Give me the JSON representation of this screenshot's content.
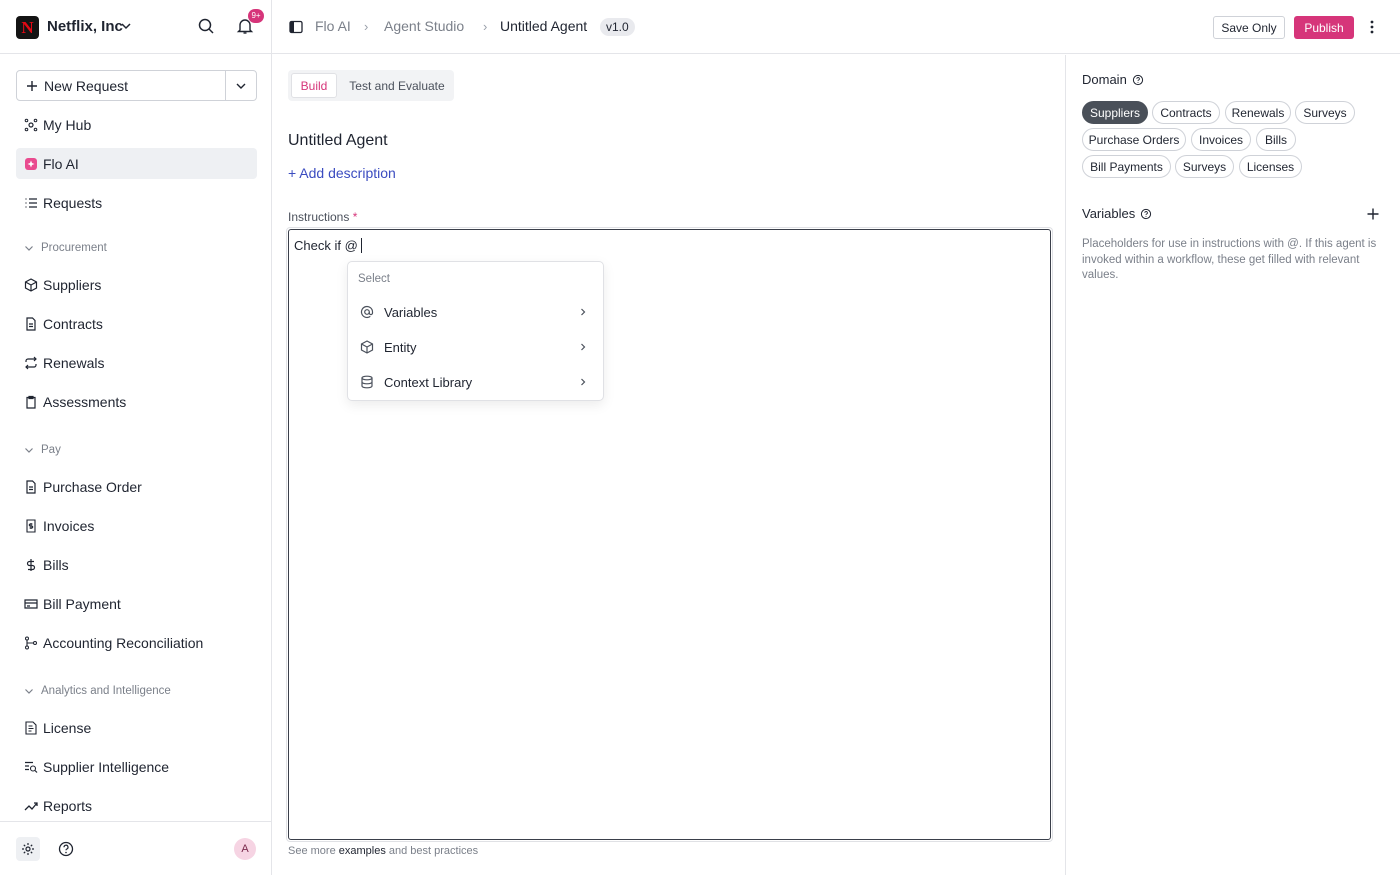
{
  "org": {
    "name": "Netflix, Inc",
    "logo_letter": "N",
    "notifications": "9+"
  },
  "sidebar": {
    "new_request": "New Request",
    "items_top": [
      {
        "label": "My Hub",
        "icon": "hub-icon"
      },
      {
        "label": "Flo AI",
        "icon": "flo-ai-icon"
      },
      {
        "label": "Requests",
        "icon": "list-icon"
      }
    ],
    "sections": [
      {
        "title": "Procurement",
        "items": [
          {
            "label": "Suppliers",
            "icon": "cube-icon"
          },
          {
            "label": "Contracts",
            "icon": "document-icon"
          },
          {
            "label": "Renewals",
            "icon": "repeat-icon"
          },
          {
            "label": "Assessments",
            "icon": "clipboard-icon"
          }
        ]
      },
      {
        "title": "Pay",
        "items": [
          {
            "label": "Purchase Order",
            "icon": "document-icon"
          },
          {
            "label": "Invoices",
            "icon": "receipt-icon"
          },
          {
            "label": "Bills",
            "icon": "dollar-icon"
          },
          {
            "label": "Bill Payment",
            "icon": "card-icon"
          },
          {
            "label": "Accounting Reconciliation",
            "icon": "branch-icon"
          }
        ]
      },
      {
        "title": "Analytics and Intelligence",
        "items": [
          {
            "label": "License",
            "icon": "license-icon"
          },
          {
            "label": "Supplier Intelligence",
            "icon": "search-list-icon"
          },
          {
            "label": "Reports",
            "icon": "trend-icon"
          }
        ]
      }
    ],
    "avatar": "A"
  },
  "header": {
    "breadcrumbs": [
      "Flo AI",
      "Agent Studio",
      "Untitled Agent"
    ],
    "version": "v1.0",
    "save_label": "Save Only",
    "publish_label": "Publish"
  },
  "main": {
    "tabs": [
      "Build",
      "Test and Evaluate"
    ],
    "agent_title": "Untitled Agent",
    "add_description": "+ Add description",
    "instructions_label": "Instructions",
    "required_mark": "*",
    "instructions_value": "Check if @",
    "dropdown": {
      "header": "Select",
      "items": [
        "Variables",
        "Entity",
        "Context Library"
      ]
    },
    "hint_prefix": "See more ",
    "hint_link": "examples",
    "hint_suffix": " and best practices"
  },
  "right_panel": {
    "domain_title": "Domain",
    "domain_chips": [
      "Suppliers",
      "Contracts",
      "Renewals",
      "Surveys",
      "Purchase Orders",
      "Invoices",
      "Bills",
      "Bill Payments",
      "Surveys",
      "Licenses"
    ],
    "selected_chip": "Suppliers",
    "variables_title": "Variables",
    "variables_desc": "Placeholders for use in instructions with @. If this agent is invoked within a workflow, these get filled with relevant values."
  },
  "colors": {
    "accent": "#d6357a",
    "link": "#3b4cc0",
    "chip_selected": "#4a5059"
  }
}
